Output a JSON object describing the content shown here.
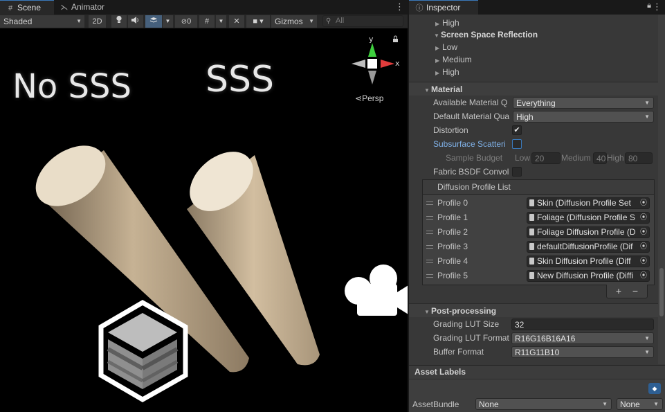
{
  "scene_tabs": {
    "scene": "Scene",
    "animator": "Animator"
  },
  "toolbar": {
    "shading_mode": "Shaded",
    "btn_2d": "2D",
    "hidden_count": "0",
    "gizmos": "Gizmos",
    "search_placeholder": "All"
  },
  "viewport": {
    "label_left": "No SSS",
    "label_right": "SSS",
    "projection": "Persp",
    "axis_y": "y",
    "axis_x": "x"
  },
  "inspector": {
    "tab_title": "Inspector",
    "top_rows": [
      {
        "label": "High",
        "indent": 2,
        "expanded": false
      },
      {
        "label": "Screen Space Reflection",
        "indent": 1,
        "expanded": true
      },
      {
        "label": "Low",
        "indent": 2,
        "expanded": false
      },
      {
        "label": "Medium",
        "indent": 2,
        "expanded": false
      },
      {
        "label": "High",
        "indent": 2,
        "expanded": false
      }
    ],
    "material": {
      "section": "Material",
      "available_quality_label": "Available Material Q",
      "available_quality_value": "Everything",
      "default_quality_label": "Default Material Qua",
      "default_quality_value": "High",
      "distortion_label": "Distortion",
      "distortion_checked": true,
      "sss_label": "Subsurface Scatteri",
      "sss_checked": false,
      "sample_budget_label": "Sample Budget",
      "budget_low_label": "Low",
      "budget_low_value": "20",
      "budget_medium_label": "Medium",
      "budget_medium_value": "40",
      "budget_high_label": "High",
      "budget_high_value": "80",
      "fabric_label": "Fabric BSDF Convol",
      "fabric_checked": false,
      "diffusion_list_title": "Diffusion Profile List",
      "profiles": [
        {
          "label": "Profile 0",
          "value": "Skin (Diffusion Profile Set"
        },
        {
          "label": "Profile 1",
          "value": "Foliage (Diffusion Profile S"
        },
        {
          "label": "Profile 2",
          "value": "Foliage Diffusion Profile (D"
        },
        {
          "label": "Profile 3",
          "value": "defaultDiffusionProfile (Dif"
        },
        {
          "label": "Profile 4",
          "value": "Skin Diffusion Profile (Diff"
        },
        {
          "label": "Profile 5",
          "value": "New Diffusion Profile (Diffi"
        }
      ],
      "add": "+",
      "remove": "−"
    },
    "post": {
      "section": "Post-processing",
      "lut_size_label": "Grading LUT Size",
      "lut_size_value": "32",
      "lut_format_label": "Grading LUT Format",
      "lut_format_value": "R16G16B16A16",
      "buffer_format_label": "Buffer Format",
      "buffer_format_value": "R11G11B10"
    },
    "asset_labels": {
      "title": "Asset Labels",
      "bundle_label": "AssetBundle",
      "bundle_value": "None",
      "variant_value": "None"
    }
  },
  "colors": {
    "accent": "#3a79bb",
    "panel": "#383838",
    "rod": "#c9b597",
    "rod_cap": "#eadfce",
    "axis_y": "#3ecf3e",
    "axis_x": "#e23c3c"
  }
}
